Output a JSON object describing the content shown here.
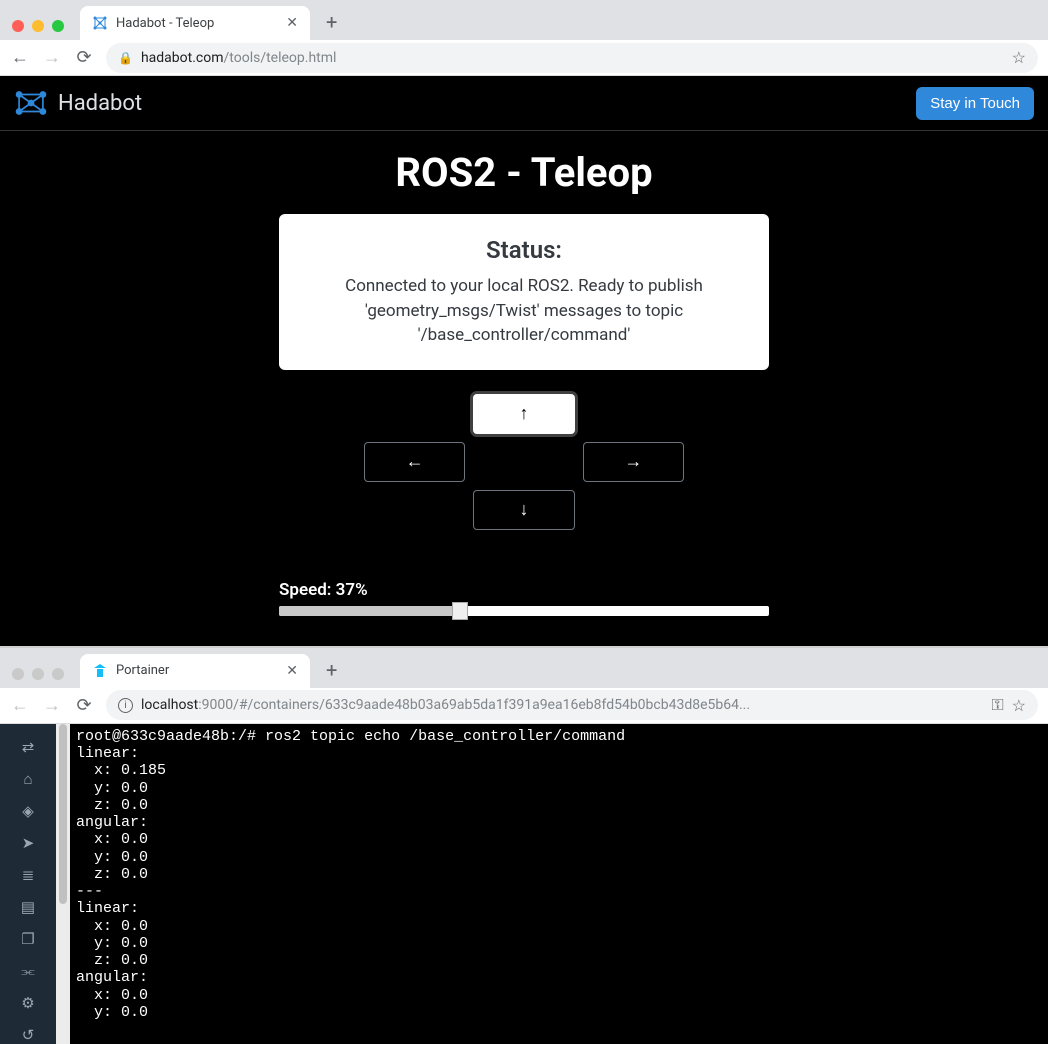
{
  "window_top": {
    "tab_title": "Hadabot - Teleop",
    "url_host": "hadabot.com",
    "url_path": "/tools/teleop.html"
  },
  "teleop": {
    "brand": "Hadabot",
    "cta_button": "Stay in Touch",
    "title": "ROS2 - Teleop",
    "status_heading": "Status:",
    "status_body": "Connected to your local ROS2. Ready to publish 'geometry_msgs/Twist' messages to topic '/base_controller/command'",
    "speed_label_prefix": "Speed: ",
    "speed_percent": 37,
    "speed_label_full": "Speed: 37%"
  },
  "window_bottom": {
    "tab_title": "Portainer",
    "url_host": "localhost",
    "url_port": ":9000",
    "url_path": "/#/containers/633c9aade48b03a69ab5da1f391a9ea16eb8fd54b0bcb43d8e5b64..."
  },
  "terminal": {
    "prompt": "root@633c9aade48b:/#",
    "command": "ros2 topic echo /base_controller/command",
    "output": "linear:\n  x: 0.185\n  y: 0.0\n  z: 0.0\nangular:\n  x: 0.0\n  y: 0.0\n  z: 0.0\n---\nlinear:\n  x: 0.0\n  y: 0.0\n  z: 0.0\nangular:\n  x: 0.0\n  y: 0.0"
  },
  "portainer_sidebar_icons": [
    "swap-icon",
    "home-icon",
    "dashboard-icon",
    "rocket-icon",
    "list-icon",
    "box-icon",
    "layers-icon",
    "network-icon",
    "settings-icon",
    "history-icon"
  ]
}
